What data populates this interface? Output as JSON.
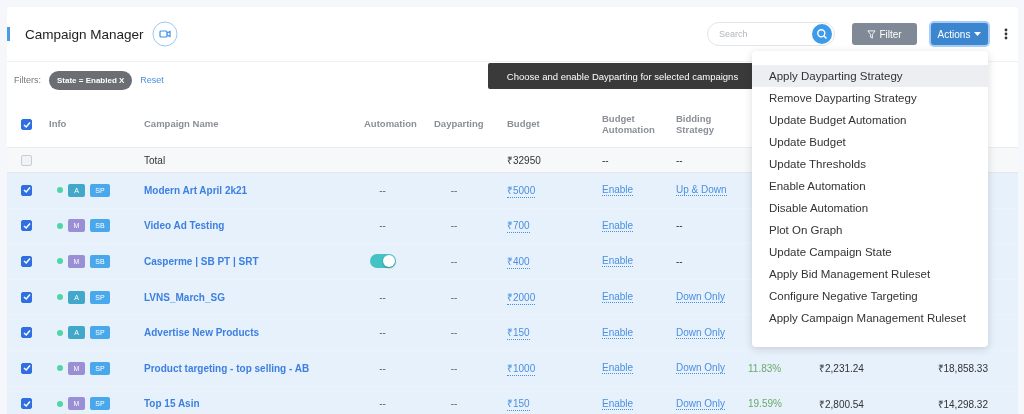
{
  "header": {
    "title": "Campaign Manager",
    "search": {
      "placeholder": "Search"
    },
    "filter_button": "Filter",
    "actions_button": "Actions"
  },
  "filters": {
    "label": "Filters:",
    "chips": [
      "State = Enabled X"
    ],
    "reset": "Reset"
  },
  "tooltip": "Choose and enable Dayparting for selected campaigns",
  "actions_menu": [
    {
      "label": "Apply Dayparting Strategy",
      "selected": true
    },
    {
      "label": "Remove Dayparting Strategy",
      "selected": false
    },
    {
      "label": "Update Budget Automation",
      "selected": false
    },
    {
      "label": "Update Budget",
      "selected": false
    },
    {
      "label": "Update Thresholds",
      "selected": false
    },
    {
      "label": "Enable Automation",
      "selected": false
    },
    {
      "label": "Disable Automation",
      "selected": false
    },
    {
      "label": "Plot On Graph",
      "selected": false
    },
    {
      "label": "Update Campaign State",
      "selected": false
    },
    {
      "label": "Apply Bid Management Ruleset",
      "selected": false
    },
    {
      "label": "Configure Negative Targeting",
      "selected": false
    },
    {
      "label": "Apply Campaign Management Ruleset",
      "selected": false
    }
  ],
  "table": {
    "all_checked": true,
    "columns": [
      "Info",
      "Campaign Name",
      "Automation",
      "Dayparting",
      "Budget",
      "Budget Automation",
      "Bidding Strategy"
    ],
    "total": {
      "checked": false,
      "label": "Total",
      "budget": "₹32950",
      "budget_automation": "--",
      "bidding": "--"
    },
    "rows": [
      {
        "checked": true,
        "selected": true,
        "mode": "A",
        "type": "SP",
        "name": "Modern Art April 2k21",
        "automation": {
          "kind": "text",
          "text": "--"
        },
        "dayparting": "--",
        "budget": "₹5000",
        "budget_automation": "Enable",
        "bidding": {
          "text": "Up & Down",
          "link": true
        }
      },
      {
        "checked": true,
        "selected": true,
        "mode": "M",
        "type": "SB",
        "name": "Video Ad Testing",
        "automation": {
          "kind": "text",
          "text": "--"
        },
        "dayparting": "--",
        "budget": "₹700",
        "budget_automation": "Enable",
        "bidding": {
          "text": "--",
          "link": false
        }
      },
      {
        "checked": true,
        "selected": true,
        "mode": "M",
        "type": "SB",
        "name": "Casperme | SB PT | SRT",
        "automation": {
          "kind": "toggle",
          "on": true
        },
        "dayparting": "--",
        "budget": "₹400",
        "budget_automation": "Enable",
        "bidding": {
          "text": "--",
          "link": false
        }
      },
      {
        "checked": true,
        "selected": true,
        "mode": "A",
        "type": "SP",
        "name": "LVNS_March_SG",
        "automation": {
          "kind": "text",
          "text": "--"
        },
        "dayparting": "--",
        "budget": "₹2000",
        "budget_automation": "Enable",
        "bidding": {
          "text": "Down Only",
          "link": true
        }
      },
      {
        "checked": true,
        "selected": true,
        "mode": "A",
        "type": "SP",
        "name": "Advertise New Products",
        "automation": {
          "kind": "text",
          "text": "--"
        },
        "dayparting": "--",
        "budget": "₹150",
        "budget_automation": "Enable",
        "bidding": {
          "text": "Down Only",
          "link": true
        }
      },
      {
        "checked": true,
        "selected": true,
        "mode": "M",
        "type": "SP",
        "name": "Product targeting - top selling - AB",
        "automation": {
          "kind": "text",
          "text": "--"
        },
        "dayparting": "--",
        "budget": "₹1000",
        "budget_automation": "Enable",
        "bidding": {
          "text": "Down Only",
          "link": true
        },
        "column_8": "11.83%",
        "column_9": "₹2,231.24",
        "column_10": "₹18,858.33"
      },
      {
        "checked": true,
        "selected": true,
        "mode": "M",
        "type": "SP",
        "name": "Top 15 Asin",
        "automation": {
          "kind": "text",
          "text": "--"
        },
        "dayparting": "--",
        "budget": "₹150",
        "budget_automation": "Enable",
        "bidding": {
          "text": "Down Only",
          "link": true
        },
        "column_8": "19.59%",
        "column_9": "₹2,800.54",
        "column_10": "₹14,298.32"
      }
    ]
  }
}
